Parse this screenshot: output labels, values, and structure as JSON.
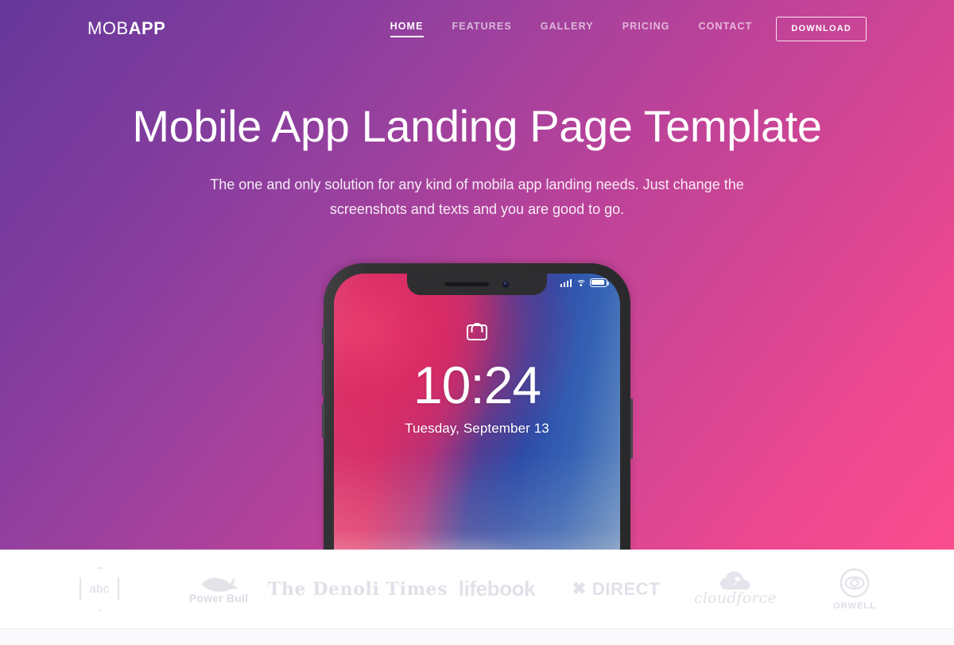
{
  "brand": {
    "logo_light": "MOB",
    "logo_bold": "APP"
  },
  "nav": {
    "items": [
      {
        "label": "HOME",
        "active": true
      },
      {
        "label": "FEATURES",
        "active": false
      },
      {
        "label": "GALLERY",
        "active": false
      },
      {
        "label": "PRICING",
        "active": false
      },
      {
        "label": "CONTACT",
        "active": false
      }
    ],
    "cta_label": "DOWNLOAD"
  },
  "hero": {
    "title": "Mobile App Landing Page Template",
    "subtitle": "The one and only solution for any kind of mobila app landing needs. Just change the screenshots and texts and you are good to go."
  },
  "phone": {
    "lock_icon": "lock-icon",
    "time": "10:24",
    "date": "Tuesday, September 13",
    "status": {
      "signal_icon": "signal-bars-icon",
      "wifi_icon": "wifi-icon",
      "battery_icon": "battery-icon"
    }
  },
  "clients": [
    {
      "name": "abc",
      "icon": "hexagon-abc-logo"
    },
    {
      "name": "Power Bull",
      "icon": "bull-logo"
    },
    {
      "name": "The Denoli Times",
      "icon": "newspaper-wordmark"
    },
    {
      "name": "lifebook",
      "icon": "lifebook-wordmark"
    },
    {
      "name": "DIRECT",
      "icon": "x-direct-logo"
    },
    {
      "name": "cloudforce",
      "icon": "cloud-logo"
    },
    {
      "name": "ORWELL",
      "icon": "eye-logo"
    }
  ],
  "colors": {
    "gradient_start": "#66389a",
    "gradient_mid": "#b8429a",
    "gradient_end": "#fa4d8e",
    "nav_text": "#ffffff",
    "client_logo": "#e3e2ea"
  }
}
